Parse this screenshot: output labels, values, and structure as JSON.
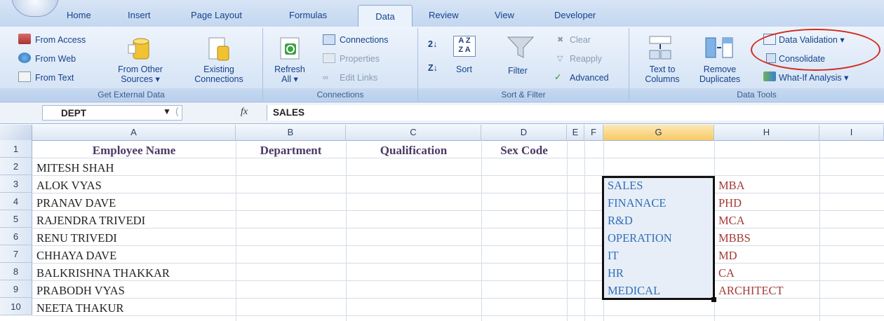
{
  "tabs": [
    "Home",
    "Insert",
    "Page Layout",
    "Formulas",
    "Data",
    "Review",
    "View",
    "Developer"
  ],
  "active_tab": "Data",
  "groups": {
    "external": {
      "label": "Get External Data",
      "from_access": "From Access",
      "from_web": "From Web",
      "from_text": "From Text",
      "from_other_1": "From Other",
      "from_other_2": "Sources ▾",
      "existing_1": "Existing",
      "existing_2": "Connections"
    },
    "connections": {
      "label": "Connections",
      "refresh_1": "Refresh",
      "refresh_2": "All ▾",
      "connections": "Connections",
      "properties": "Properties",
      "edit_links": "Edit Links"
    },
    "sortfilter": {
      "label": "Sort & Filter",
      "sort": "Sort",
      "filter": "Filter",
      "clear": "Clear",
      "reapply": "Reapply",
      "advanced": "Advanced"
    },
    "datatools": {
      "label": "Data Tools",
      "text_to_1": "Text to",
      "text_to_2": "Columns",
      "remove_1": "Remove",
      "remove_2": "Duplicates",
      "data_validation": "Data Validation ▾",
      "consolidate": "Consolidate",
      "what_if": "What-If Analysis ▾"
    }
  },
  "formula_bar": {
    "name_box": "DEPT",
    "fx": "fx",
    "value": "SALES"
  },
  "columns": [
    "A",
    "B",
    "C",
    "D",
    "E",
    "F",
    "G",
    "H",
    "I"
  ],
  "rows": [
    "1",
    "2",
    "3",
    "4",
    "5",
    "6",
    "7",
    "8",
    "9",
    "10"
  ],
  "headers": {
    "a": "Employee Name",
    "b": "Department",
    "c": "Qualification",
    "d": "Sex Code"
  },
  "employees": [
    "MITESH SHAH",
    "ALOK VYAS",
    "PRANAV DAVE",
    "RAJENDRA TRIVEDI",
    "RENU TRIVEDI",
    "CHHAYA DAVE",
    "BALKRISHNA THAKKAR",
    "PRABODH VYAS",
    "NEETA THAKUR"
  ],
  "departments": [
    "SALES",
    "FINANACE",
    "R&D",
    "OPERATION",
    "IT",
    "HR",
    "MEDICAL"
  ],
  "qualifications": [
    "MBA",
    "PHD",
    "MCA",
    "MBBS",
    "MD",
    "CA",
    "ARCHITECT"
  ]
}
